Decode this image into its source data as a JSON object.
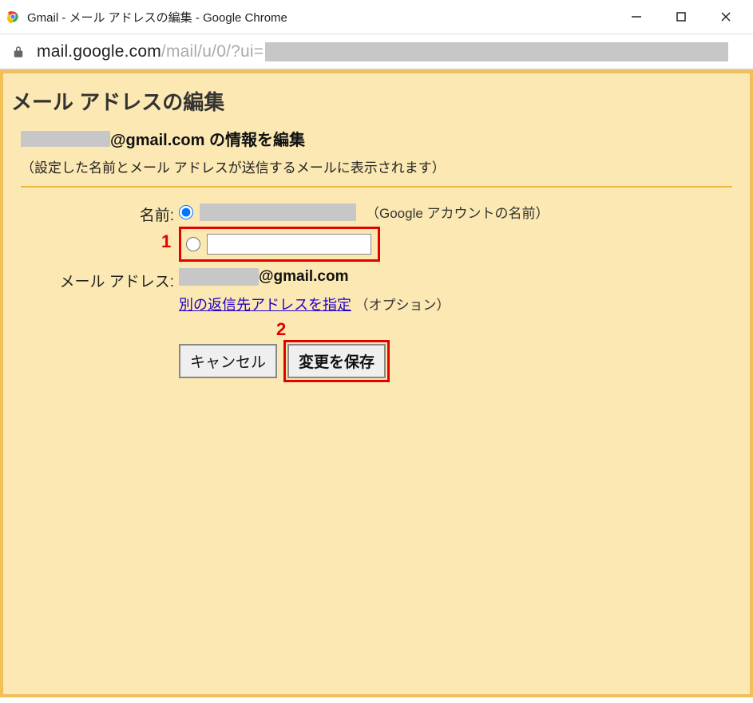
{
  "window": {
    "title": "Gmail - メール アドレスの編集 - Google Chrome"
  },
  "addressbar": {
    "url_host": "mail.google.com",
    "url_path": "/mail/u/0/?ui="
  },
  "page": {
    "title": "メール アドレスの編集",
    "heading_domain": "@gmail.com の情報を編集",
    "subheading": "（設定した名前とメール アドレスが送信するメールに表示されます）",
    "labels": {
      "name": "名前:",
      "email": "メール アドレス:"
    },
    "name_google_note": "（Google アカウントの名前）",
    "custom_name_value": "",
    "email_domain": "@gmail.com",
    "reply_link_text": "別の返信先アドレスを指定",
    "option_note": "（オプション）",
    "buttons": {
      "cancel": "キャンセル",
      "save": "変更を保存"
    },
    "annotations": {
      "one": "1",
      "two": "2"
    }
  }
}
